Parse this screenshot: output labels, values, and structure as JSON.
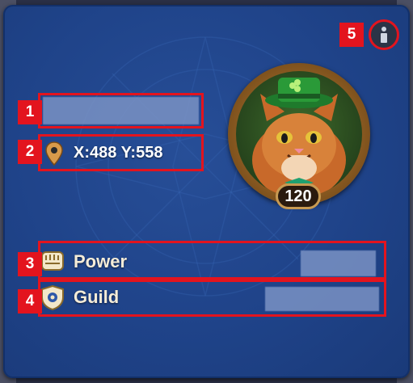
{
  "player": {
    "name": "",
    "coordinates": "X:488 Y:558",
    "level": "120",
    "power_value": "",
    "guild_value": ""
  },
  "rows": {
    "power_label": "Power",
    "guild_label": "Guild"
  },
  "annotations": [
    "1",
    "2",
    "3",
    "4",
    "5"
  ],
  "icons": {
    "location": "map-pin-icon",
    "power": "fist-icon",
    "guild": "guild-shield-icon",
    "info": "info-icon"
  },
  "colors": {
    "panel": "#1f4389",
    "highlight": "#e3141e",
    "ring": "#b57c33"
  }
}
